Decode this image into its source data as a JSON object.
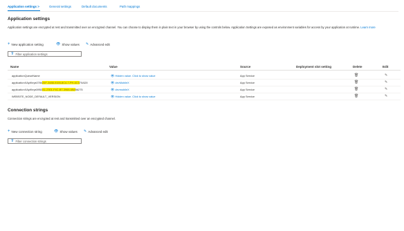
{
  "tabs": [
    {
      "label": "Application settings",
      "active": true
    },
    {
      "label": "General settings"
    },
    {
      "label": "Default documents"
    },
    {
      "label": "Path mappings"
    }
  ],
  "tab_separator": ">",
  "app_settings": {
    "title": "Application settings",
    "description": "Application settings are encrypted at rest and transmitted over an encrypted channel. You can choose to display them in plain text in your browser by using the controls below. Application Settings are exposed as environment variables for access by your application at runtime.",
    "learn_more": "Learn more",
    "commands": {
      "new": "New application setting",
      "show": "Show values",
      "advanced": "Advanced edit"
    },
    "filter_placeholder": "Filter application settings",
    "columns": [
      "Name",
      "Value",
      "Source",
      "Deployment slot setting",
      "Delete",
      "Edit"
    ],
    "rows": [
      {
        "name": "applicationQueueName",
        "name_hl": "",
        "name_suffix": "",
        "value": "Hidden value. Click to show value",
        "source": "App Service"
      },
      {
        "name": "applicationXApiKeys0784",
        "name_hl": "26F-3488-9155-8C4-7-PH-6C5",
        "name_suffix": "70AD0",
        "value": "devMobileX",
        "source": "App Service"
      },
      {
        "name": "applicationXApiKeys5952",
        "name_hl": "A1-2301-F4C-B7-3968-6B8",
        "name_suffix": "56275",
        "value": "devmobileX",
        "source": "App Service"
      },
      {
        "name": "WEBSITE_NODE_DEFAULT_VERSION",
        "name_hl": "",
        "name_suffix": "",
        "value": "Hidden value. Click to show value",
        "source": "App Service"
      }
    ]
  },
  "connection_strings": {
    "title": "Connection strings",
    "description": "Connection strings are encrypted at rest and transmitted over an encrypted channel.",
    "commands": {
      "new": "New connection string",
      "show": "Show values",
      "advanced": "Advanced edit"
    },
    "filter_placeholder": "Filter connection strings"
  },
  "icons": {
    "plus": "plus-icon",
    "eye": "eye-icon",
    "pencil": "pencil-icon",
    "filter": "filter-icon",
    "trash": "trash-icon"
  },
  "colors": {
    "accent": "#0078d4",
    "highlight": "#fff200"
  }
}
